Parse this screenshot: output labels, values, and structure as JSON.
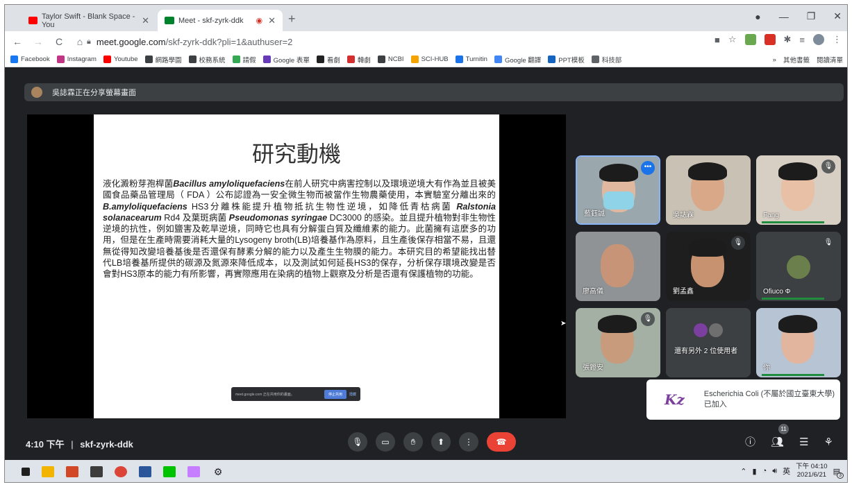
{
  "browser": {
    "tabs": [
      {
        "title": "Taylor Swift - Blank Space - You",
        "active": false,
        "fav_color": "#ff0000"
      },
      {
        "title": "Meet - skf-zyrk-ddk",
        "active": true,
        "fav_color": "#00832d",
        "recording": true
      }
    ],
    "url_host": "meet.google.com",
    "url_path": "/skf-zyrk-ddk?pli=1&authuser=2",
    "bookmarks": [
      {
        "label": "Facebook",
        "color": "#1877f2"
      },
      {
        "label": "Instagram",
        "color": "#c13584"
      },
      {
        "label": "Youtube",
        "color": "#ff0000"
      },
      {
        "label": "網路學園",
        "color": "#3c4043"
      },
      {
        "label": "校務系統",
        "color": "#3c4043"
      },
      {
        "label": "請假",
        "color": "#34a853"
      },
      {
        "label": "Google 表單",
        "color": "#673ab7"
      },
      {
        "label": "看劇",
        "color": "#222222"
      },
      {
        "label": "韓劇",
        "color": "#d32f2f"
      },
      {
        "label": "NCBI",
        "color": "#3c4043"
      },
      {
        "label": "SCI-HUB",
        "color": "#f4a300"
      },
      {
        "label": "Turnitin",
        "color": "#1a73e8"
      },
      {
        "label": "Google 翻譯",
        "color": "#4285f4"
      },
      {
        "label": "PPT模板",
        "color": "#1565c0"
      },
      {
        "label": "科技部",
        "color": "#5f6368"
      }
    ],
    "bookmarks_right": [
      "»",
      "其他書籤",
      "閱讀清單"
    ]
  },
  "meet": {
    "share_banner": "吳誌霖正在分享螢幕畫面",
    "slide": {
      "title": "研究動機",
      "body": [
        {
          "t": "液化澱粉芽孢桿菌"
        },
        {
          "t": "Bacillus amyloliquefaciens",
          "i": true
        },
        {
          "t": "在前人研究中病害控制以及環境逆境大有作為並且被美國食品藥品管理局（ FDA ）公布認證為一安全微生物而被當作生物農藥使用，本實驗室分離出來的"
        },
        {
          "t": "B.amyloliquefaciens",
          "i": true
        },
        {
          "t": " HS3分離株能提升植物抵抗生物性逆境，如降低青枯病菌 "
        },
        {
          "t": "Ralstonia solanacearum",
          "i": true
        },
        {
          "t": " Rd4 及葉斑病菌 "
        },
        {
          "t": "Pseudomonas syringae",
          "i": true
        },
        {
          "t": " DC3000 的感染。並且提升植物對非生物性逆境的抗性，例如鹽害及乾旱逆境，同時它也具有分解蛋白質及纖維素的能力。此菌擁有這麼多的功用，但是在生產時需要消耗大量的Lysogeny broth(LB)培養基作為原料，且生產後保存相當不易，且還無從得知改變培養基後是否還保有酵素分解的能力以及產生生物膜的能力。本研究目的希望能找出替代LB培養基所提供的碳源及氮源來降低成本，以及測試如何延長HS3的保存，分析保存環境改變是否會對HS3原本的能力有所影響，再實際應用在染病的植物上觀察及分析是否還有保護植物的功能。"
        }
      ],
      "share_bar_text": "meet.google.com 正在共用你的畫面。",
      "share_bar_stop": "停止共用",
      "share_bar_hide": "隱藏"
    },
    "participants": [
      {
        "name": "藍鈺誠",
        "mute": false,
        "more": true
      },
      {
        "name": "吳誌霖",
        "mute": false
      },
      {
        "name": "Fang",
        "mute": true
      },
      {
        "name": "廖高儀",
        "mute": false
      },
      {
        "name": "劉孟鑫",
        "mute": true
      },
      {
        "name": "Ofiuco Φ",
        "mute": true,
        "avatar": true
      },
      {
        "name": "張鐙安",
        "mute": true
      },
      {
        "name": "還有另外 2 位使用者",
        "mute": false,
        "group": true
      },
      {
        "name": "你",
        "mute": false
      }
    ],
    "toast": {
      "text": "Escherichia Coli (不屬於國立臺東大學) 已加入"
    },
    "time": "4:10 下午",
    "separator": "|",
    "meeting_code": "skf-zyrk-ddk",
    "participant_count": "11"
  },
  "taskbar": {
    "clock_time": "下午 04:10",
    "clock_date": "2021/6/21",
    "ime": "英",
    "notif": "3"
  }
}
